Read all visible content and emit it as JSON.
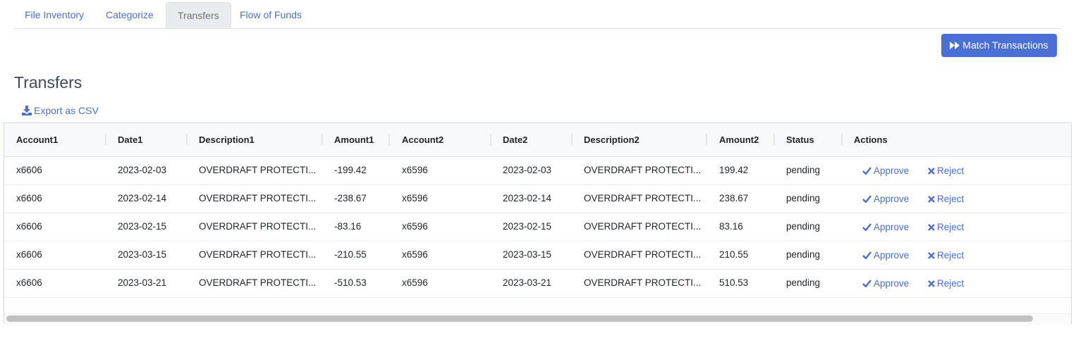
{
  "tabs": [
    {
      "label": "File Inventory"
    },
    {
      "label": "Categorize"
    },
    {
      "label": "Transfers",
      "active": true
    },
    {
      "label": "Flow of Funds"
    }
  ],
  "toolbar": {
    "match_label": "Match Transactions",
    "match_icon": "fast-forward-icon"
  },
  "page_title": "Transfers",
  "export_label": "Export as CSV",
  "colors": {
    "accent": "#4a6fd6"
  },
  "table": {
    "columns": [
      "Account1",
      "Date1",
      "Description1",
      "Amount1",
      "Account2",
      "Date2",
      "Description2",
      "Amount2",
      "Status",
      "Actions"
    ],
    "approve_label": "Approve",
    "reject_label": "Reject",
    "rows": [
      [
        "x6606",
        "2023-02-03",
        "OVERDRAFT PROTECTI...",
        "-199.42",
        "x6596",
        "2023-02-03",
        "OVERDRAFT PROTECTI...",
        "199.42",
        "pending"
      ],
      [
        "x6606",
        "2023-02-14",
        "OVERDRAFT PROTECTI...",
        "-238.67",
        "x6596",
        "2023-02-14",
        "OVERDRAFT PROTECTI...",
        "238.67",
        "pending"
      ],
      [
        "x6606",
        "2023-02-15",
        "OVERDRAFT PROTECTI...",
        "-83.16",
        "x6596",
        "2023-02-15",
        "OVERDRAFT PROTECTI...",
        "83.16",
        "pending"
      ],
      [
        "x6606",
        "2023-03-15",
        "OVERDRAFT PROTECTI...",
        "-210.55",
        "x6596",
        "2023-03-15",
        "OVERDRAFT PROTECTI...",
        "210.55",
        "pending"
      ],
      [
        "x6606",
        "2023-03-21",
        "OVERDRAFT PROTECTI...",
        "-510.53",
        "x6596",
        "2023-03-21",
        "OVERDRAFT PROTECTI...",
        "510.53",
        "pending"
      ]
    ]
  }
}
